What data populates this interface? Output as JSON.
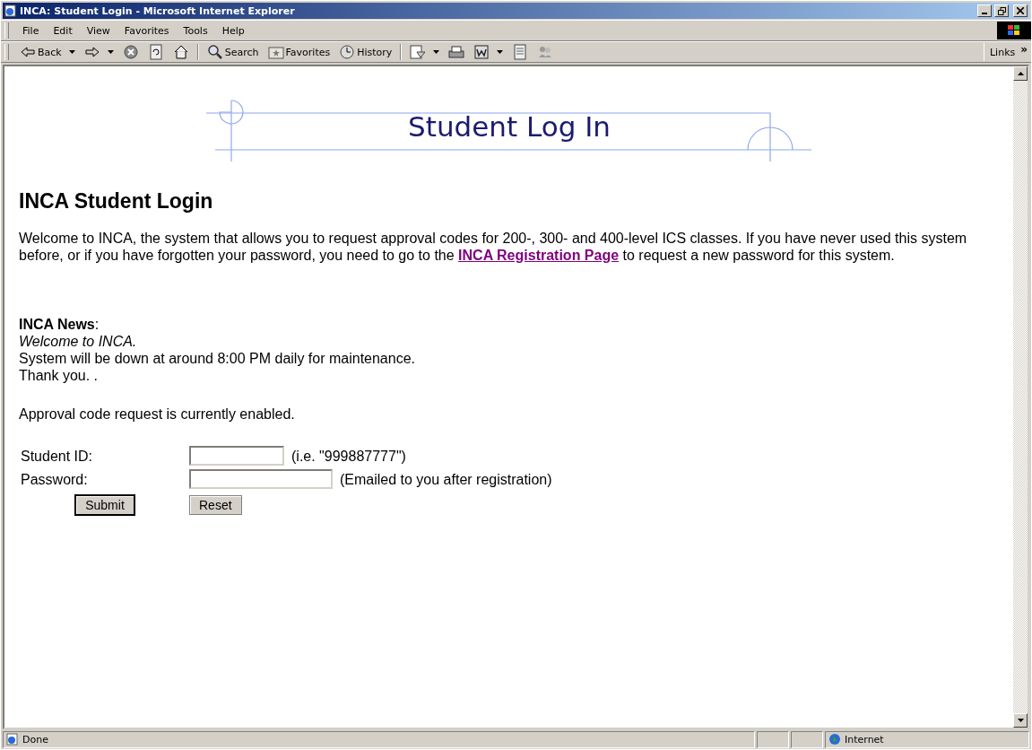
{
  "window": {
    "title": "INCA: Student Login - Microsoft Internet Explorer"
  },
  "menu": [
    "File",
    "Edit",
    "View",
    "Favorites",
    "Tools",
    "Help"
  ],
  "toolbar": [
    {
      "kind": "back",
      "label": "Back",
      "dropdown": true
    },
    {
      "kind": "forward",
      "dropdown": true
    },
    {
      "kind": "stop",
      "dropdown": false
    },
    {
      "kind": "refresh",
      "dropdown": false
    },
    {
      "kind": "home",
      "dropdown": false
    },
    {
      "kind": "search",
      "label": "Search",
      "dropdown": false
    },
    {
      "kind": "favorites",
      "label": "Favorites",
      "dropdown": false
    },
    {
      "kind": "history",
      "label": "History",
      "dropdown": false
    },
    {
      "kind": "mail",
      "dropdown": true
    },
    {
      "kind": "print",
      "dropdown": false
    },
    {
      "kind": "word",
      "dropdown": true
    },
    {
      "kind": "discuss",
      "dropdown": false
    },
    {
      "kind": "messenger",
      "dropdown": false
    }
  ],
  "links": {
    "label": "Links",
    "chevron": "»"
  },
  "page": {
    "banner_title": "Student Log In",
    "heading": "INCA Student Login",
    "intro": {
      "before": "Welcome to INCA, the system that allows you to request approval codes for 200-, 300- and 400-level ICS classes. If you have never used this system before, or if you have forgotten your password, you need to go to the ",
      "link": "INCA Registration Page",
      "after": " to request a new password for this system."
    },
    "news_label": "**INCA News**:",
    "news": [
      {
        "text": "Welcome to INCA.",
        "italic": true
      },
      {
        "text": "System will be down at around 8:00 PM daily for maintenance.",
        "italic": false
      },
      {
        "text": "Thank you. .",
        "italic": false
      }
    ],
    "status_message": "Approval code request is currently enabled.",
    "fields": [
      {
        "label": "Student ID:",
        "kind": "text",
        "hint": "(i.e. \"999887777\")"
      },
      {
        "label": "Password:",
        "kind": "password",
        "hint": "(Emailed to you after registration)"
      }
    ],
    "buttons": [
      {
        "label": "Submit",
        "default": true
      },
      {
        "label": "Reset",
        "default": false
      }
    ]
  },
  "status_bar": {
    "text": "Done",
    "zone": "Internet"
  }
}
